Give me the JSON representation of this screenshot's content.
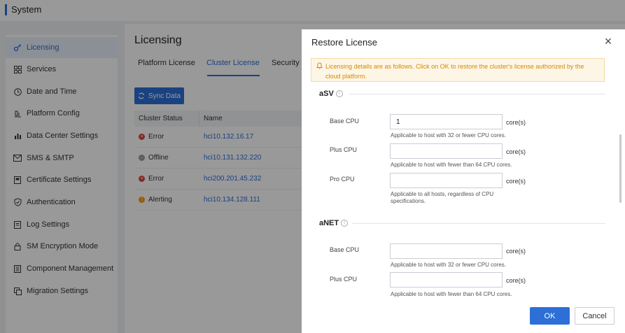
{
  "app": {
    "title": "System"
  },
  "sidebar": {
    "items": [
      {
        "label": "Licensing",
        "icon": "key-icon",
        "active": true
      },
      {
        "label": "Services",
        "icon": "grid-icon"
      },
      {
        "label": "Date and Time",
        "icon": "clock-icon"
      },
      {
        "label": "Platform Config",
        "icon": "platform-icon"
      },
      {
        "label": "Data Center Settings",
        "icon": "bar-chart-icon"
      },
      {
        "label": "SMS & SMTP",
        "icon": "mail-icon"
      },
      {
        "label": "Certificate Settings",
        "icon": "certificate-icon"
      },
      {
        "label": "Authentication",
        "icon": "shield-icon"
      },
      {
        "label": "Log Settings",
        "icon": "log-icon"
      },
      {
        "label": "SM Encryption Mode",
        "icon": "lock-icon"
      },
      {
        "label": "Component Management",
        "icon": "component-icon"
      },
      {
        "label": "Migration Settings",
        "icon": "migration-icon"
      }
    ]
  },
  "main": {
    "title": "Licensing",
    "tabs": [
      {
        "label": "Platform License"
      },
      {
        "label": "Cluster License",
        "active": true
      },
      {
        "label": "Security F"
      }
    ],
    "sync_label": "Sync Data",
    "table": {
      "headers": [
        "Cluster Status",
        "Name"
      ],
      "rows": [
        {
          "status": "Error",
          "name": "hci10.132.16.17"
        },
        {
          "status": "Offline",
          "name": "hci10.131.132.220"
        },
        {
          "status": "Error",
          "name": "hci200.201.45.232"
        },
        {
          "status": "Alerting",
          "name": "hci10.134.128.111"
        }
      ]
    }
  },
  "modal": {
    "title": "Restore License",
    "notice": "Licensing details are as follows. Click on OK to restore the cluster's license authorized by the cloud platform.",
    "sections": [
      {
        "title": "aSV",
        "fields": [
          {
            "label": "Base CPU",
            "value": "1",
            "unit": "core(s)",
            "hint": "Applicable to host with 32 or fewer CPU cores."
          },
          {
            "label": "Plus CPU",
            "value": "",
            "unit": "core(s)",
            "hint": "Applicable to host with fewer than 64 CPU cores."
          },
          {
            "label": "Pro CPU",
            "value": "",
            "unit": "core(s)",
            "hint": "Applicable to all hosts, regardless of CPU specifications."
          }
        ]
      },
      {
        "title": "aNET",
        "fields": [
          {
            "label": "Base CPU",
            "value": "",
            "unit": "core(s)",
            "hint": "Applicable to host with 32 or fewer CPU cores."
          },
          {
            "label": "Plus CPU",
            "value": "",
            "unit": "core(s)",
            "hint": "Applicable to host with fewer than 64 CPU cores."
          }
        ]
      }
    ],
    "ok_label": "OK",
    "cancel_label": "Cancel"
  },
  "colors": {
    "accent": "#2d6fd6",
    "error": "#e0453a",
    "offline": "#9a9a9a",
    "alerting": "#f39c12",
    "notice_bg": "#fdf6e6",
    "notice_text": "#d48806"
  }
}
